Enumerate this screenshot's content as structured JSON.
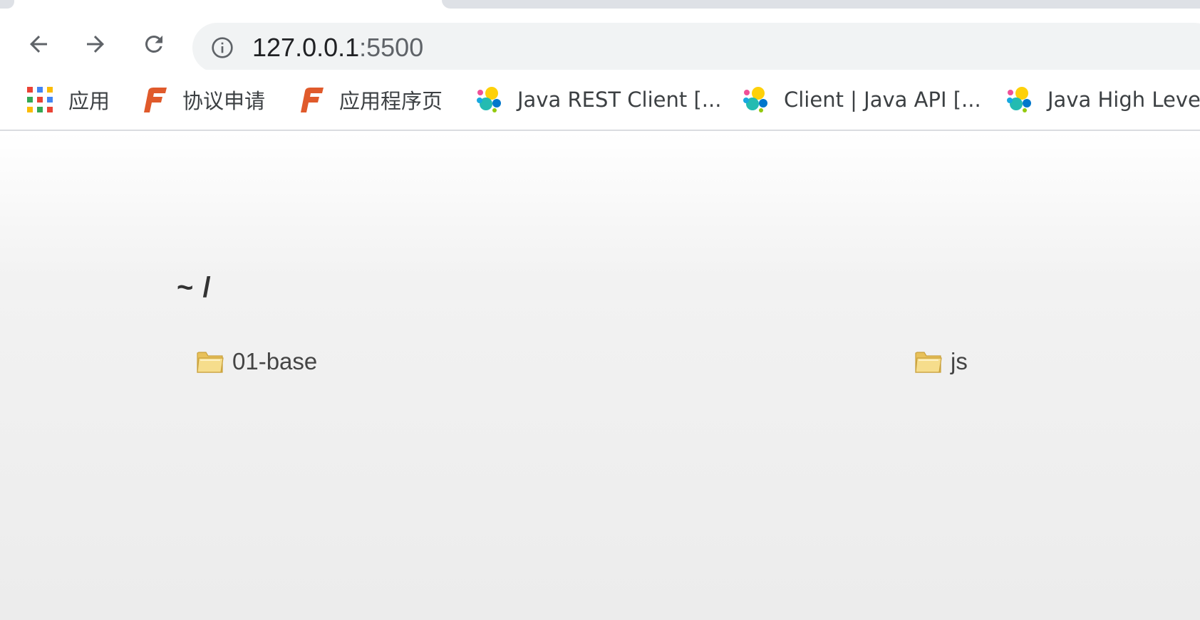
{
  "browser": {
    "url_host": "127.0.0.1",
    "url_port": ":5500",
    "icons": {
      "back": "arrow-left-icon",
      "forward": "arrow-right-icon",
      "reload": "reload-icon",
      "site_info": "info-icon"
    }
  },
  "bookmarks": [
    {
      "label": "应用",
      "icon": "apps-grid-icon"
    },
    {
      "label": "协议申请",
      "icon": "f-logo-icon"
    },
    {
      "label": "应用程序页",
      "icon": "f-logo-icon"
    },
    {
      "label": "Java REST Client [...",
      "icon": "elastic-logo-icon"
    },
    {
      "label": "Client | Java API [...",
      "icon": "elastic-logo-icon"
    },
    {
      "label": "Java High Leve",
      "icon": "elastic-logo-icon"
    }
  ],
  "listing": {
    "breadcrumb": "~ /",
    "items": [
      {
        "name": "01-base",
        "icon": "folder-icon"
      },
      {
        "name": "js",
        "icon": "folder-icon"
      }
    ]
  },
  "colors": {
    "omnibox_bg": "#f1f3f4",
    "tab_inactive_bg": "#dee1e6",
    "f_logo": "#e05a2b",
    "folder_fill": "#f3d77e"
  }
}
